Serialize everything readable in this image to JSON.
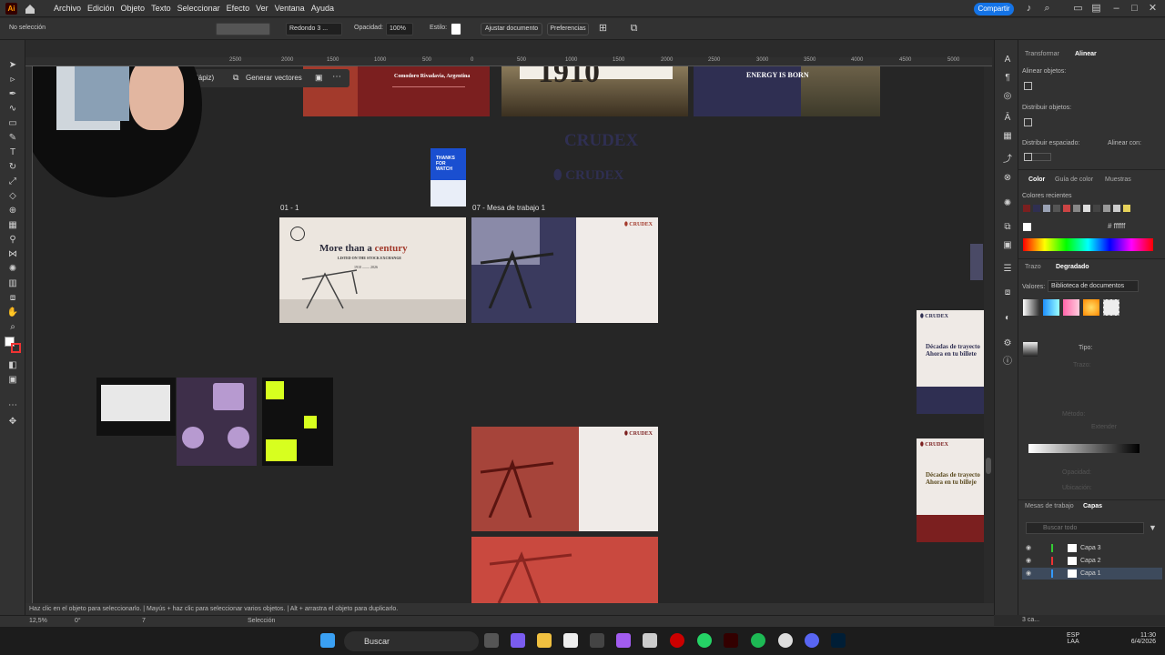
{
  "menubar": {
    "app_logo": "Ai",
    "menus": [
      "Archivo",
      "Edición",
      "Objeto",
      "Texto",
      "Seleccionar",
      "Efecto",
      "Ver",
      "Ventana",
      "Ayuda"
    ],
    "share_label": "Compartir"
  },
  "control_bar": {
    "selection": "No selección",
    "brush": "Redondo 3 ...",
    "opacity_label": "Opacidad:",
    "opacity_value": "100%",
    "style_label": "Estilo:",
    "align_doc": "Ajustar documento",
    "preferences": "Preferencias"
  },
  "context_bar": {
    "pencil_label": "lápiz)",
    "generate_vectors": "Generar vectores"
  },
  "ruler_top": [
    "2500",
    "2000",
    "1500",
    "1000",
    "500",
    "0",
    "500",
    "1000",
    "1500",
    "2000",
    "2500",
    "3000",
    "3500",
    "4000",
    "4500",
    "5000"
  ],
  "artboards": {
    "ab_01": "01 - 1",
    "ab_07": "07 - Mesa de trabajo 1",
    "title_main": "More than a ",
    "title_accent": "century",
    "subtitle": "LISTED ON THE STOCK EXCHANGE",
    "years_from": "1910",
    "years_to": "2026",
    "crudex": "CRUDEX",
    "crudex_small": "CRUDEX",
    "year_big": "1910",
    "energy": "ENERGY IS BORN",
    "comodoro": "Comodoro Rivadavia, Argentina",
    "decadas_1": "Décadas de trayecto",
    "decadas_2": "Ahora en tu billete",
    "decadas_3": "Décadas de trayecto",
    "decadas_4": "Ahora en tu billeje",
    "thanks": "THANKS FOR WATCH"
  },
  "status": {
    "hint": "Haz clic en el objeto para seleccionarlo. | Mayús + haz clic para seleccionar varios objetos. | Alt + arrastra el objeto para duplicarlo.",
    "zoom": "12,5%",
    "rotation": "0°",
    "page": "7",
    "tool": "Selección"
  },
  "panel": {
    "tabs": [
      "Transformar",
      "Alinear"
    ],
    "align_objects": "Alinear objetos:",
    "distribute_objects": "Distribuir objetos:",
    "distribute_spacing": "Distribuir espaciado:",
    "align_to": "Alinear con:",
    "color_tabs": [
      "Color",
      "Guía de color",
      "Muestras"
    ],
    "recent_colors": "Colores recientes",
    "hex": "ffffff",
    "stroke_tabs": [
      "Trazo",
      "Degradado"
    ],
    "values_label": "Valores:",
    "values_select": "Biblioteca de documentos",
    "type_label": "Tipo:",
    "stroke_label": "Trazo:",
    "method_label": "Método:",
    "expand_label": "Extender",
    "opacity_label": "Opacidad:",
    "location_label": "Ubicación:",
    "layer_tabs": [
      "Mesas de trabajo",
      "Capas"
    ],
    "search_placeholder": "Buscar todo",
    "layers": [
      "Capa 3",
      "Capa 2",
      "Capa 1"
    ],
    "layers_count": "3 ca..."
  },
  "taskbar": {
    "search": "Buscar",
    "lang": "ESP",
    "lang2": "LAA",
    "time": "11:30",
    "date": "6/4/2026"
  },
  "colors": {
    "accent": "#1473e6",
    "ai_orange": "#ff9a00",
    "crudex_red": "#a33a2c",
    "navy": "#2f2f52"
  }
}
